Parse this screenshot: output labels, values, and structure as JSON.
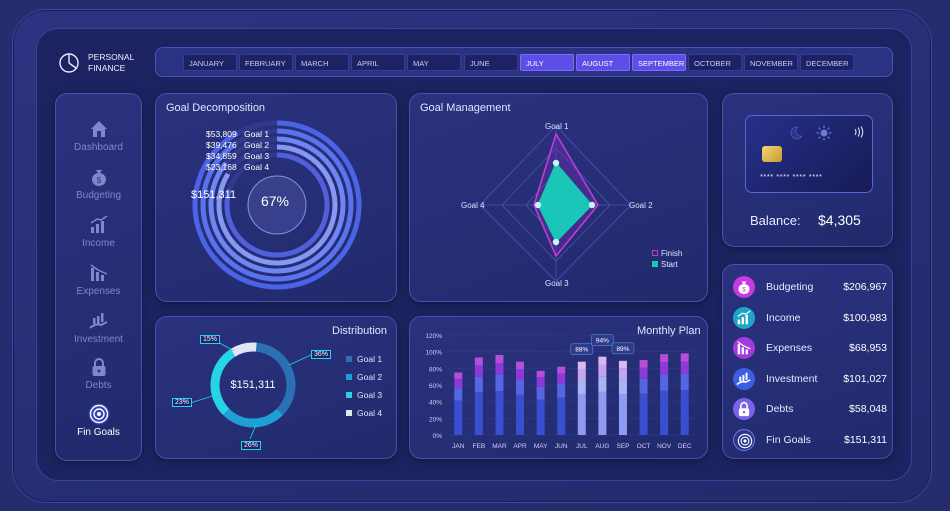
{
  "brand": {
    "line1": "PERSONAL",
    "line2": "FINANCE"
  },
  "months": [
    {
      "label": "JANUARY",
      "active": false
    },
    {
      "label": "FEBRUARY",
      "active": false
    },
    {
      "label": "MARCH",
      "active": false
    },
    {
      "label": "APRIL",
      "active": false
    },
    {
      "label": "MAY",
      "active": false
    },
    {
      "label": "JUNE",
      "active": false
    },
    {
      "label": "JULY",
      "active": true
    },
    {
      "label": "AUGUST",
      "active": true
    },
    {
      "label": "SEPTEMBER",
      "active": true
    },
    {
      "label": "OCTOBER",
      "active": false
    },
    {
      "label": "NOVEMBER",
      "active": false
    },
    {
      "label": "DECEMBER",
      "active": false
    }
  ],
  "sidebar": {
    "items": [
      {
        "label": "Dashboard",
        "icon": "home-icon",
        "active": false
      },
      {
        "label": "Budgeting",
        "icon": "money-bag-icon",
        "active": false
      },
      {
        "label": "Income",
        "icon": "bar-chart-up-icon",
        "active": false
      },
      {
        "label": "Expenses",
        "icon": "bar-chart-down-icon",
        "active": false
      },
      {
        "label": "Investment",
        "icon": "investment-icon",
        "active": false
      },
      {
        "label": "Debts",
        "icon": "padlock-icon",
        "active": false
      },
      {
        "label": "Fin Goals",
        "icon": "target-icon",
        "active": true
      }
    ]
  },
  "goal_decomposition": {
    "title": "Goal Decomposition",
    "total": "$151,311",
    "center": "67%",
    "rows": [
      {
        "amount": "$53,809",
        "label": "Goal 1"
      },
      {
        "amount": "$39,476",
        "label": "Goal 2"
      },
      {
        "amount": "$34,859",
        "label": "Goal 3"
      },
      {
        "amount": "$23,168",
        "label": "Goal 4"
      }
    ]
  },
  "goal_management": {
    "title": "Goal Management",
    "axes": [
      "Goal 1",
      "Goal 2",
      "Goal 3",
      "Goal 4"
    ],
    "legend": [
      {
        "label": "Finish",
        "color": "#c13bd8"
      },
      {
        "label": "Start",
        "color": "#19c6b8"
      }
    ]
  },
  "card": {
    "number": "**** **** **** ****",
    "balance_label": "Balance:",
    "balance_value": "$4,305"
  },
  "distribution": {
    "title": "Distribution",
    "total": "$151,311",
    "labels": [
      "15%",
      "36%",
      "23%",
      "26%"
    ],
    "legend": [
      {
        "label": "Goal 1",
        "color": "#2b6fb4"
      },
      {
        "label": "Goal 2",
        "color": "#1e9fd6"
      },
      {
        "label": "Goal 3",
        "color": "#25d4e6"
      },
      {
        "label": "Goal 4",
        "color": "#e2e6f4"
      }
    ]
  },
  "chart_data": {
    "type": "bar",
    "title": "Monthly Plan",
    "categories": [
      "JAN",
      "FEB",
      "MAR",
      "APR",
      "MAY",
      "JUN",
      "JUL",
      "AUG",
      "SEP",
      "OCT",
      "NOV",
      "DEC"
    ],
    "totals": [
      75,
      93,
      96,
      88,
      77,
      82,
      88,
      94,
      89,
      90,
      97,
      98
    ],
    "callouts": [
      {
        "month": "JUL",
        "label": "88%"
      },
      {
        "month": "AUG",
        "label": "94%"
      },
      {
        "month": "SEP",
        "label": "89%"
      }
    ],
    "yticks": [
      "0%",
      "20%",
      "40%",
      "60%",
      "80%",
      "100%",
      "120%"
    ],
    "ylim": [
      0,
      120
    ]
  },
  "summary": [
    {
      "label": "Budgeting",
      "value": "$206,967",
      "icon": "money-bag-icon",
      "color": "#c43be0"
    },
    {
      "label": "Income",
      "value": "$100,983",
      "icon": "bar-chart-up-icon",
      "color": "#1fa5c9"
    },
    {
      "label": "Expenses",
      "value": "$68,953",
      "icon": "bar-chart-down-icon",
      "color": "#a33bdc"
    },
    {
      "label": "Investment",
      "value": "$101,027",
      "icon": "investment-icon",
      "color": "#3b5fe0"
    },
    {
      "label": "Debts",
      "value": "$58,048",
      "icon": "padlock-icon",
      "color": "#7a63e8"
    },
    {
      "label": "Fin Goals",
      "value": "$151,311",
      "icon": "target-icon",
      "color": "#2d3690"
    }
  ]
}
